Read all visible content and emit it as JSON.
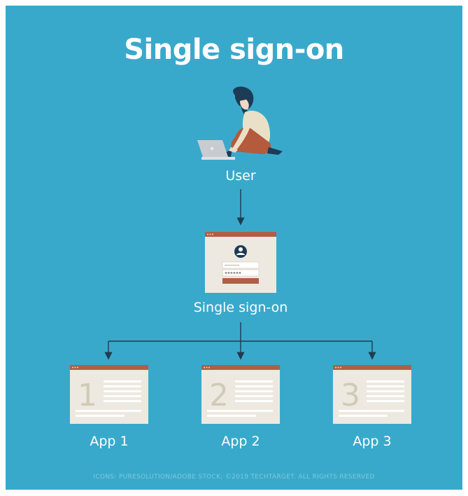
{
  "title": "Single sign-on",
  "nodes": {
    "user": "User",
    "sso": "Single sign-on",
    "apps": [
      {
        "label": "App 1",
        "number": "1"
      },
      {
        "label": "App 2",
        "number": "2"
      },
      {
        "label": "App 3",
        "number": "3"
      }
    ]
  },
  "credit": "ICONS: PURESOLUTION/ADOBE STOCK; ©2019 TECHTARGET. ALL RIGHTS RESERVED",
  "colors": {
    "background": "#39a9cb",
    "window_bar": "#b25d45",
    "window_body": "#ede9e0",
    "connector": "#1f3c52"
  }
}
